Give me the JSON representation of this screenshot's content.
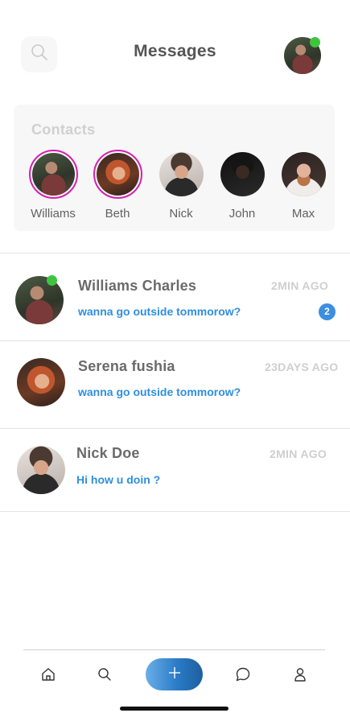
{
  "header": {
    "title": "Messages",
    "search_icon": "search-icon",
    "online_color": "#3ec53e"
  },
  "contacts": {
    "title": "Contacts",
    "items": [
      {
        "name": "Williams",
        "active": true
      },
      {
        "name": "Beth",
        "active": true
      },
      {
        "name": "Nick",
        "active": false
      },
      {
        "name": "John",
        "active": false
      },
      {
        "name": "Max",
        "active": false
      }
    ],
    "ring_color": "#d61fb3"
  },
  "conversations": [
    {
      "name": "Williams Charles",
      "time": "2MIN AGO",
      "message": "wanna go outside tommorow?",
      "unread": "2",
      "online": true
    },
    {
      "name": "Serena fushia",
      "time": "23DAYS AGO",
      "message": "wanna go outside tommorow?",
      "online": false
    },
    {
      "name": "Nick Doe",
      "time": "2MIN AGO",
      "message": "Hi how u doin ?",
      "online": false
    }
  ],
  "colors": {
    "accent": "#2f8fdf",
    "badge": "#3b8ee0"
  },
  "bottom_nav": {
    "items": [
      "home-icon",
      "search-icon",
      "plus-icon",
      "chat-bubble-icon",
      "profile-icon"
    ]
  }
}
